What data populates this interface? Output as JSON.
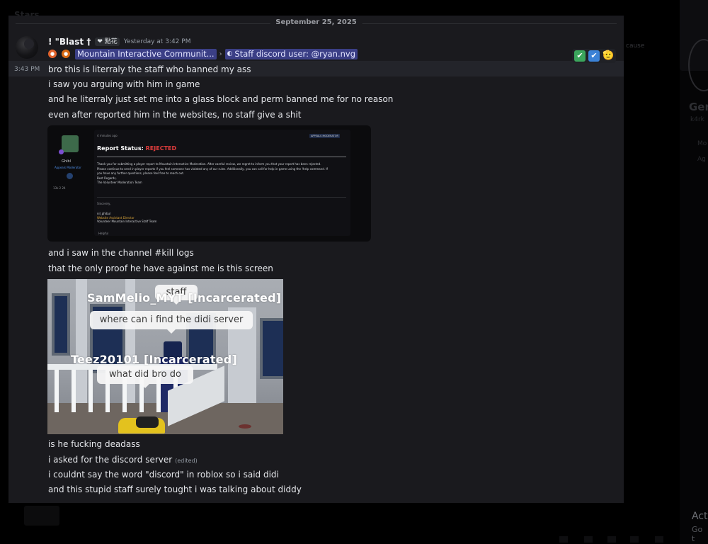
{
  "background": {
    "top_left_text": "Stars",
    "right_name": "Ger",
    "right_sub": "k4rk",
    "right_label1": "Mo",
    "right_label2": "Ag",
    "side_text": "cause",
    "activate_title": "Act",
    "activate_sub": "Go t"
  },
  "date_divider": "September 25, 2025",
  "message": {
    "author": "! \"Blast †",
    "tag": "❤ 點花",
    "timestamp": "Yesterday at 3:42 PM",
    "side_time": "3:43 PM",
    "reply": {
      "server": "Mountain Interactive Communit...",
      "separator": "›",
      "channel": "Staff discord user: @ryan.nvg"
    },
    "reactions": [
      "✔",
      "✔",
      "🫡"
    ],
    "lines": [
      "bro this is literraly the staff who banned my ass",
      "i saw you arguing with him in game",
      "and he literraly just set me into a glass block and perm banned me for no reason",
      "even after reported him in the websites, no staff give a shit"
    ],
    "lines_after_embed": [
      "and i saw in the channel #kill logs",
      "that the only proof he have against me is this screen"
    ],
    "lines_after_screenshot": [
      "is he fucking deadass",
      "i asked for the discord server",
      "i couldnt say the word \"discord\" in roblox so i said didi",
      "and this stupid staff surely tought i was talking about diddy"
    ],
    "edited_label": "(edited)"
  },
  "embed": {
    "sidebar_name": "Ghibl",
    "sidebar_role": "Appeals Moderator",
    "sidebar_stats": "13k   2   24",
    "time": "4 minutes ago",
    "badge": "APPEALS MODERATOR",
    "title_prefix": "Report Status: ",
    "title_status": "REJECTED",
    "body_lines": [
      "Thank you for submitting a player report to Mountain Interactive Moderation. After careful review, we regret to inform you that your report has been rejected.",
      "Please continue to send in player reports if you feel someone has violated any of our rules. Additionally, you can call for help in game using the !help command. If",
      "you have any further questions, please feel free to reach out.",
      "Best Regards,",
      "The Volunteer Moderation Team"
    ],
    "sincerely": "Sincerely,",
    "sig_name": "nil_ghibul",
    "sig_title": "Website Assistant Director",
    "sig_team": "Volunteer Mountain Interactive Staff Team",
    "helpful": "Helpful"
  },
  "screenshot": {
    "nametag_1": "SamMelio_MYT [Incarcerated]",
    "bubble_staff": "staff",
    "bubble_1": "where can i find the didi server",
    "nametag_2": "Teez20101 [Incarcerated]",
    "bubble_2": "what did bro do"
  },
  "colors": {
    "panel_bg": "#1a1a1e",
    "mention_bg": "#3b3f86",
    "rejected": "#e23d3d",
    "react_green": "#3ba55c",
    "react_blue": "#3b82d6"
  }
}
